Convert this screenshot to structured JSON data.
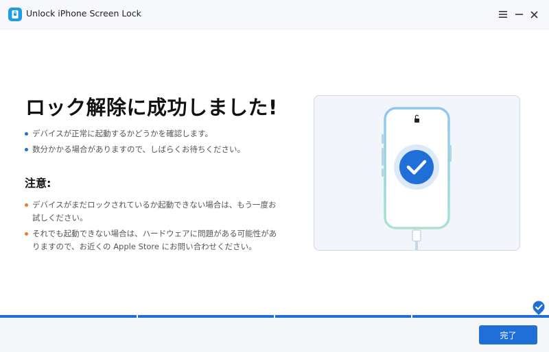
{
  "window": {
    "title": "Unlock iPhone Screen Lock",
    "icons": {
      "app": "lock-shield-icon",
      "menu": "hamburger-icon",
      "minimize": "minimize-icon",
      "close": "close-icon"
    }
  },
  "content": {
    "headline": "ロック解除に成功しました!",
    "info_items": [
      "デバイスが正常に起動するかどうかを確認します。",
      "数分かかる場合がありますので、しばらくお待ちください。"
    ],
    "note_title": "注意:",
    "note_items": [
      "デバイスがまだロックされているか起動できない場合は、もう一度お試しください。",
      "それでも起動できない場合は、ハードウェアに問題がある可能性がありますので、お近くの Apple Store にお問い合わせください。"
    ]
  },
  "illustration": {
    "icons": [
      "phone-icon",
      "unlocked-padlock-icon",
      "checkmark-icon",
      "usb-cable-icon"
    ]
  },
  "progress": {
    "steps_total": 4,
    "steps_completed": 4
  },
  "footer": {
    "done_label": "完了"
  },
  "colors": {
    "accent": "#1f6fd6",
    "bullet_info": "#1f6fd6",
    "bullet_note": "#f07c27",
    "phone_outline": "#9fd3ef"
  }
}
